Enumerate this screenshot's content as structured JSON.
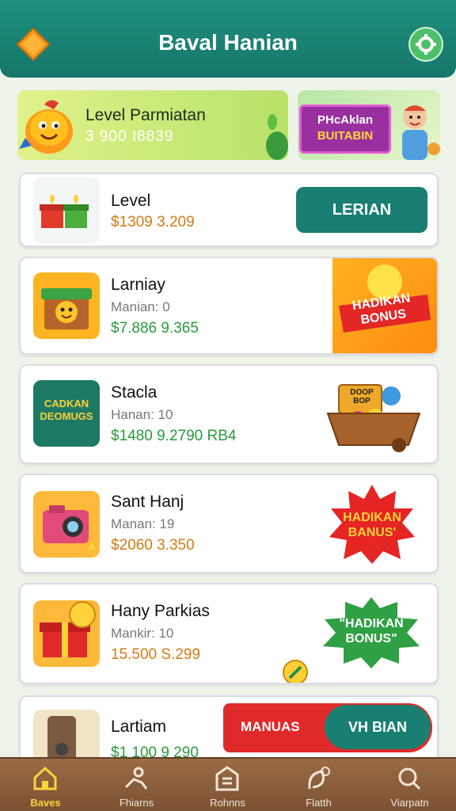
{
  "header": {
    "title": "Baval Hanian"
  },
  "banners": {
    "left": {
      "title": "Level Parmiatan",
      "subtitle": "3 900 I8839"
    },
    "right": {
      "line1": "PHcAklan",
      "line2": "BUITABIN"
    }
  },
  "cards": [
    {
      "name": "Level",
      "price": "$1309 3.209",
      "price_color": "#d47a12",
      "button": "LERIAN"
    },
    {
      "name": "Larniay",
      "sub": "Manian: 0",
      "price": "$7.886 9.365",
      "price_color": "#2a9a3a",
      "badge": "HADIKAN BONUS"
    },
    {
      "name": "Stacla",
      "sub": "Hanan: 10",
      "price": "$1480 9.2790 RB4",
      "price_color": "#2a9a3a",
      "thumb_text": "CADKAN DEOMUGS",
      "chest_sign": "DOOP BOP"
    },
    {
      "name": "Sant Hanj",
      "sub": "Manan: 19",
      "price": "$2060 3.350",
      "price_color": "#d47a12",
      "badge": "HADIKAN BANUS'"
    },
    {
      "name": "Hany Parkias",
      "sub": "Mankir: 10",
      "price": "15.500 S.299",
      "price_color": "#d47a12",
      "badge": "\"HADIKAN BONUS\""
    },
    {
      "name": "Lartiam",
      "price": "$1 100 9 290",
      "price_color": "#2a9a3a",
      "ribbon_left": "MANUAS",
      "ribbon_right": "VH BIAN"
    }
  ],
  "nav": [
    {
      "label": "Baves",
      "icon": "home-icon",
      "active": true
    },
    {
      "label": "Fhiarns",
      "icon": "person-icon"
    },
    {
      "label": "Rohnns",
      "icon": "store-icon"
    },
    {
      "label": "Flatth",
      "icon": "leaf-icon"
    },
    {
      "label": "Viarpatn",
      "icon": "search-icon"
    }
  ],
  "colors": {
    "header": "#15776a",
    "accent_green": "#4cc069",
    "button_teal": "#187f72",
    "nav_wood": "#8a5d3c"
  }
}
